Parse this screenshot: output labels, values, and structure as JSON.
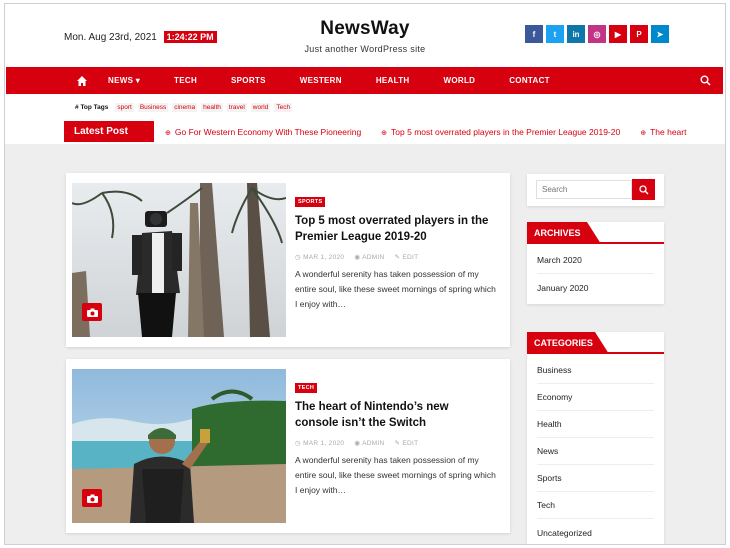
{
  "header": {
    "date": "Mon. Aug 23rd, 2021",
    "time": "1:24:22 PM",
    "site_title": "NewsWay",
    "tagline": "Just another WordPress site",
    "socials": [
      {
        "icon": "facebook-icon",
        "glyph": "f",
        "color": "#3b5998"
      },
      {
        "icon": "twitter-icon",
        "glyph": "t",
        "color": "#1da1f2"
      },
      {
        "icon": "linkedin-icon",
        "glyph": "in",
        "color": "#0e76a8"
      },
      {
        "icon": "instagram-icon",
        "glyph": "◎",
        "color": "#c13584"
      },
      {
        "icon": "youtube-icon",
        "glyph": "▶",
        "color": "#d6000f"
      },
      {
        "icon": "pinterest-icon",
        "glyph": "P",
        "color": "#d6000f"
      },
      {
        "icon": "telegram-icon",
        "glyph": "➤",
        "color": "#0088cc"
      }
    ]
  },
  "nav": {
    "items": [
      "NEWS ▾",
      "TECH",
      "SPORTS",
      "WESTERN",
      "HEALTH",
      "WORLD",
      "CONTACT"
    ]
  },
  "tags": {
    "title": "Top Tags",
    "items": [
      "sport",
      "Business",
      "cinema",
      "health",
      "travel",
      "world",
      "Tech"
    ]
  },
  "latest": {
    "label": "Latest Post",
    "items": [
      "Go For Western Economy With These Pioneering",
      "Top 5 most overrated players in the Premier League 2019-20",
      "The heart"
    ]
  },
  "posts": [
    {
      "category": "SPORTS",
      "title": "Top 5 most overrated players in the Premier League 2019-20",
      "date": "MAR 1, 2020",
      "author": "ADMIN",
      "edit": "EDIT",
      "excerpt": "A wonderful serenity has taken possession of my entire soul, like these sweet mornings of spring which I enjoy with…"
    },
    {
      "category": "TECH",
      "title": "The heart of Nintendo’s new console isn’t the Switch",
      "date": "MAR 1, 2020",
      "author": "ADMIN",
      "edit": "EDIT",
      "excerpt": "A wonderful serenity has taken possession of my entire soul, like these sweet mornings of spring which I enjoy with…"
    }
  ],
  "sidebar": {
    "search_placeholder": "Search",
    "archives": {
      "title": "ARCHIVES",
      "items": [
        "March 2020",
        "January 2020"
      ]
    },
    "categories": {
      "title": "CATEGORIES",
      "items": [
        "Business",
        "Economy",
        "Health",
        "News",
        "Sports",
        "Tech",
        "Uncategorized"
      ]
    }
  },
  "colors": {
    "accent": "#d6000f",
    "page_bg": "#eeeeee"
  }
}
